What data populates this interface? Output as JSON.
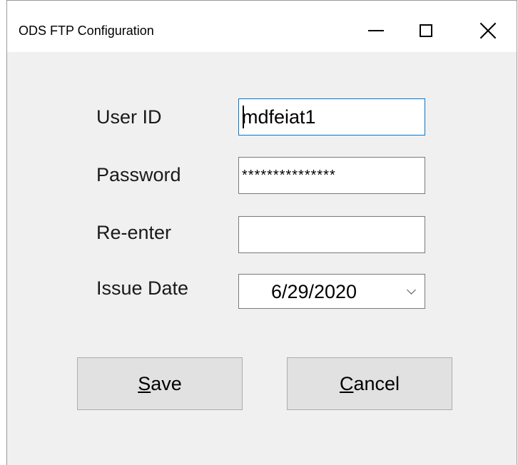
{
  "window": {
    "title": "ODS FTP Configuration"
  },
  "form": {
    "user_id_label": "User ID",
    "user_id_value": "mdfeiat1",
    "password_label": "Password",
    "password_value": "***************",
    "reenter_label": "Re-enter",
    "reenter_value": "",
    "issue_date_label": "Issue Date",
    "issue_date_value": "6/29/2020"
  },
  "buttons": {
    "save_mnemonic": "S",
    "save_rest": "ave",
    "cancel_mnemonic": "C",
    "cancel_rest": "ancel"
  },
  "icons": {
    "minimize": "minimize-icon",
    "maximize": "maximize-icon",
    "close": "close-icon",
    "dropdown": "chevron-down-icon"
  },
  "colors": {
    "focus_border": "#0078d7",
    "dialog_background": "#f0f0f0",
    "button_background": "#e1e1e1"
  }
}
